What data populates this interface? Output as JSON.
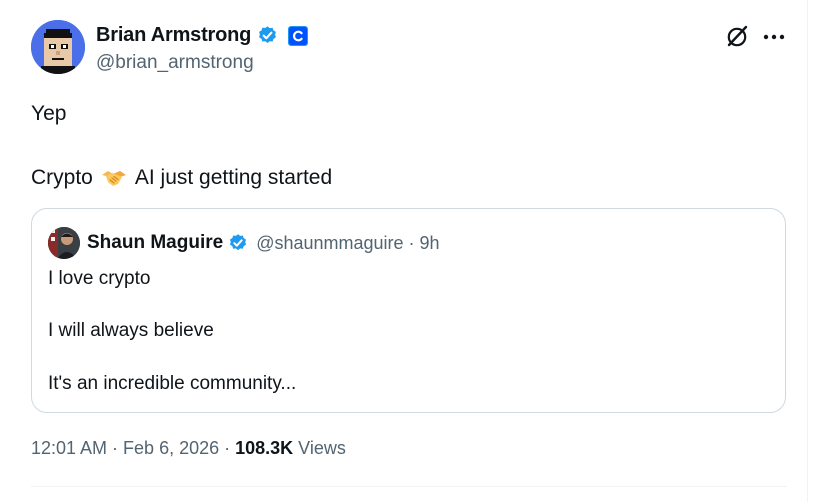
{
  "author": {
    "display_name": "Brian Armstrong",
    "handle": "@brian_armstrong"
  },
  "tweet": {
    "line1": "Yep",
    "line2_before": "Crypto",
    "line2_emoji": "handshake-emoji",
    "line2_after": "AI just getting started"
  },
  "quote": {
    "display_name": "Shaun Maguire",
    "handle_time": "@shaunmmaguire · 9h",
    "line1": "I love crypto",
    "line2": "I will always believe",
    "line3": "It's an incredible community..."
  },
  "footer": {
    "timestamp": "12:01 AM · Feb 6, 2026 · ",
    "views_count": "108.3K",
    "views_label": " Views"
  },
  "colors": {
    "accent": "#1d9bf0",
    "muted_text": "#536471",
    "org_badge": "#0052ff"
  }
}
